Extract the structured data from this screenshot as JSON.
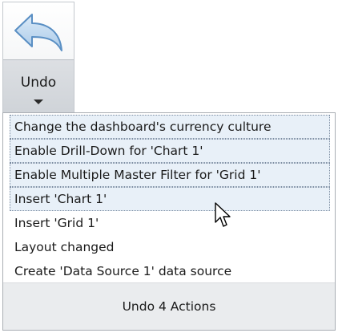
{
  "undo_button": {
    "label": "Undo",
    "icon": "undo-arrow-icon",
    "dropdown_icon": "chevron-down-icon"
  },
  "history": {
    "items": [
      {
        "label": "Change the dashboard's currency culture",
        "selected": true
      },
      {
        "label": "Enable Drill-Down for 'Chart 1'",
        "selected": true
      },
      {
        "label": "Enable Multiple Master Filter for 'Grid 1'",
        "selected": true
      },
      {
        "label": "Insert 'Chart 1'",
        "selected": true
      },
      {
        "label": "Insert 'Grid 1'",
        "selected": false
      },
      {
        "label": "Layout changed",
        "selected": false
      },
      {
        "label": "Create 'Data Source 1' data source",
        "selected": false
      }
    ],
    "footer_label": "Undo 4 Actions"
  },
  "cursor": {
    "icon": "mouse-pointer-icon"
  },
  "colors": {
    "selection": "#e8f0f8",
    "arrow_light": "#c6ddf2",
    "arrow_dark": "#5a8fc4"
  }
}
